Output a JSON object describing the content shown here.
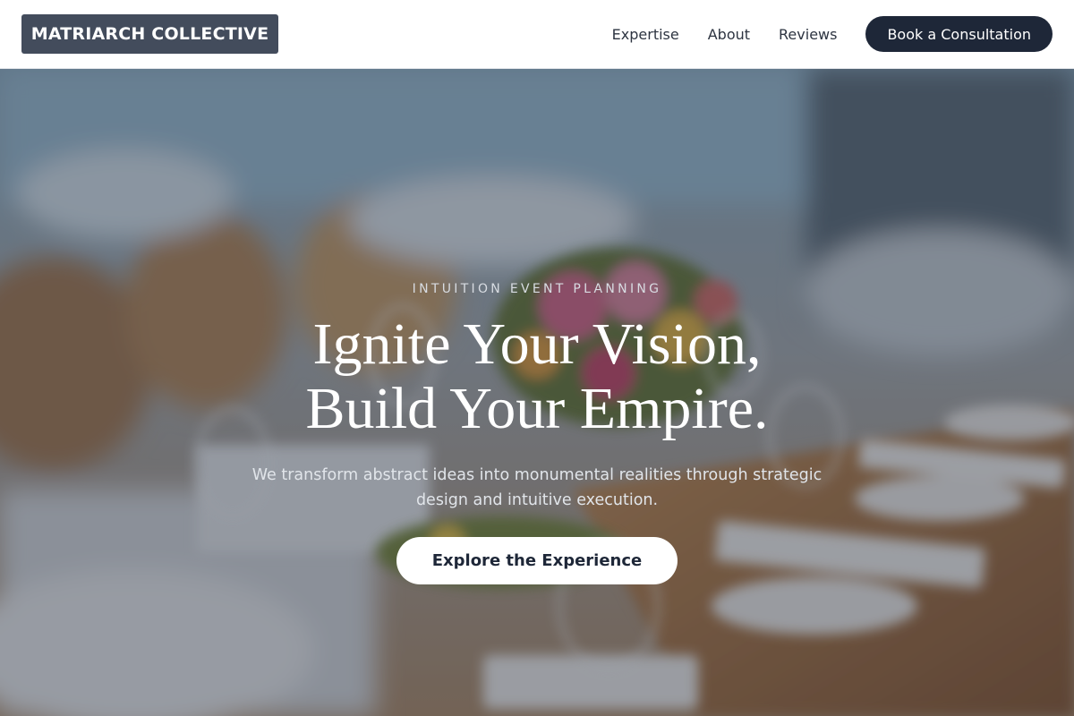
{
  "header": {
    "logo_text": "MATRIARCH COLLECTIVE",
    "nav": [
      {
        "label": "Expertise"
      },
      {
        "label": "About"
      },
      {
        "label": "Reviews"
      }
    ],
    "cta_label": "Book a Consultation"
  },
  "hero": {
    "eyebrow": "INTUITION EVENT PLANNING",
    "headline_line1": "Ignite Your Vision,",
    "headline_line2": "Build Your Empire.",
    "subtext": "We transform abstract ideas into monumental realities through strategic design and intuitive execution.",
    "cta_label": "Explore the Experience",
    "background_image": "blurred-banquet-table-photo"
  },
  "colors": {
    "logo_bg": "#434c5c",
    "primary_dark": "#1e2738",
    "nav_text": "#2d3441",
    "hero_cta_bg": "#ffffff"
  }
}
